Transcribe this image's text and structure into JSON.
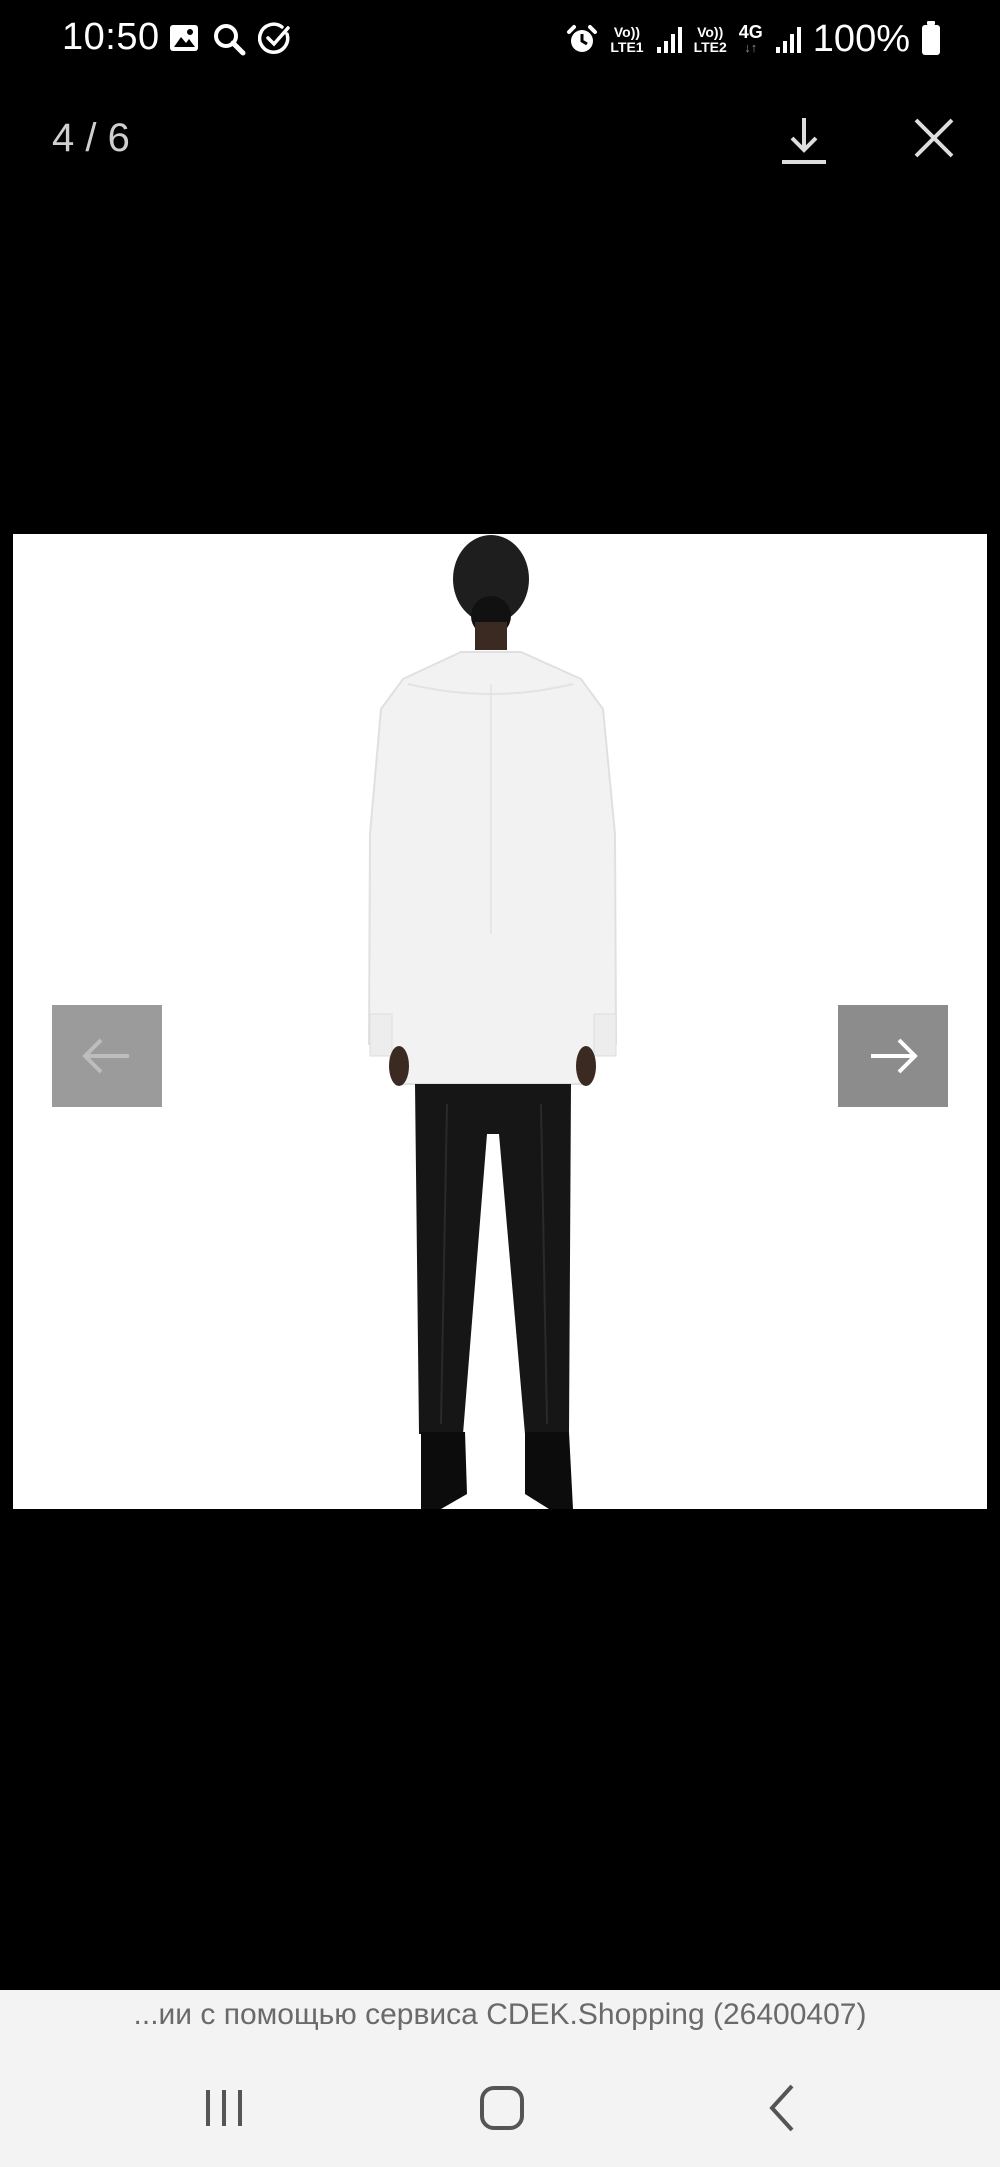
{
  "status_bar": {
    "time": "10:50",
    "sim1_label_top": "Vo))",
    "sim1_label_bottom": "LTE1",
    "sim2_label_top": "Vo))",
    "sim2_label_bottom": "LTE2",
    "network": "4G",
    "battery": "100%"
  },
  "viewer": {
    "counter": "4 / 6"
  },
  "caption": {
    "text": "...ии с помощью сервиса CDEK.Shopping (26400407)"
  },
  "colors": {
    "background": "#000000",
    "photo_background": "#ffffff",
    "nav_button": "#8c8c8c",
    "system_bar": "#f3f3f3"
  },
  "icons": [
    "image-icon",
    "search-icon",
    "check-circle-icon",
    "alarm-icon",
    "signal-icon",
    "battery-icon",
    "download-icon",
    "close-icon",
    "arrow-left-icon",
    "arrow-right-icon",
    "recents-icon",
    "home-icon",
    "back-icon"
  ]
}
